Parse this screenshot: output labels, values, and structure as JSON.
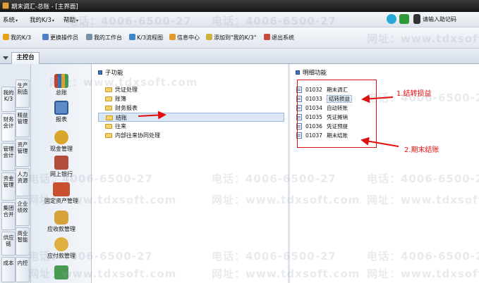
{
  "window": {
    "title": "期末调汇-总账 - [主界面]"
  },
  "menubar": {
    "items": [
      "系统",
      "我的K/3",
      "帮助"
    ],
    "help_code_label": "请输入助记码"
  },
  "toolbar": {
    "items": [
      {
        "label": "我的K/3",
        "icon": "star-icon"
      },
      {
        "label": "更换操作员",
        "icon": "user-switch-icon"
      },
      {
        "label": "我的工作台",
        "icon": "workbench-icon"
      },
      {
        "label": "K/3流程图",
        "icon": "flowchart-icon"
      },
      {
        "label": "信息中心",
        "icon": "message-icon"
      },
      {
        "label": "添加到\"我的K/3\"",
        "icon": "add-favorite-icon"
      },
      {
        "label": "退出系统",
        "icon": "exit-icon"
      }
    ]
  },
  "tabs": {
    "main_label": "主控台"
  },
  "vtabs": {
    "col1": [
      "我的K/3",
      "财务会计",
      "管理会计",
      "资金管理",
      "集团合并",
      "供应链",
      "成本"
    ],
    "col2": [
      "生产制造",
      "精益管理",
      "资产管理",
      "人力资源",
      "企业绩效",
      "商业智能",
      "内控"
    ]
  },
  "modules": [
    "总账",
    "报表",
    "现金管理",
    "网上银行",
    "固定资产管理",
    "应收款管理",
    "应付款管理"
  ],
  "subfunction": {
    "header": "子功能",
    "items": [
      "凭证处理",
      "账簿",
      "财务报表",
      "结账",
      "往来",
      "内部往来协同处理"
    ],
    "selected_index": 3
  },
  "detail": {
    "header": "明细功能",
    "items": [
      {
        "code": "01032",
        "name": "期末调汇"
      },
      {
        "code": "01033",
        "name": "结转损益"
      },
      {
        "code": "01034",
        "name": "自动转账"
      },
      {
        "code": "01035",
        "name": "凭证摊销"
      },
      {
        "code": "01036",
        "name": "凭证预提"
      },
      {
        "code": "01037",
        "name": "期末结账"
      }
    ]
  },
  "annotations": {
    "label1": "1.结转损益",
    "label2": "2.期末结账",
    "color": "#e01010"
  },
  "watermarks": {
    "phone": "电话：4006-6500-27",
    "site": "网址：www.tdxsoft.com"
  }
}
